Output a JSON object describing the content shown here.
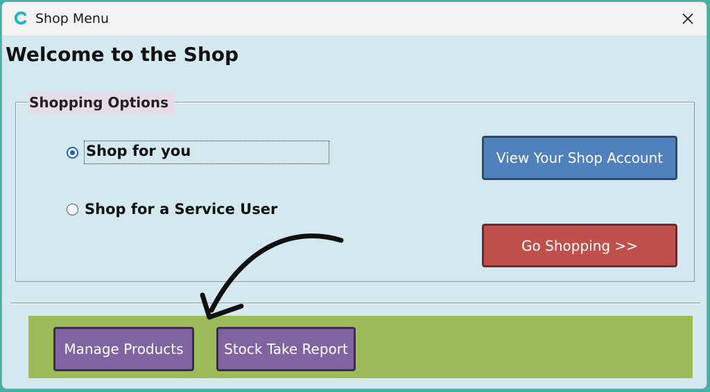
{
  "window": {
    "title": "Shop Menu",
    "app_icon": "c-logo-icon",
    "close_icon": "close-icon"
  },
  "welcome": "Welcome to the Shop",
  "shopping_options": {
    "legend": "Shopping Options",
    "radios": [
      {
        "label": "Shop for you",
        "checked": true
      },
      {
        "label": "Shop for a Service User",
        "checked": false
      }
    ],
    "view_account_label": "View Your Shop Account",
    "go_shopping_label": "Go Shopping >>"
  },
  "admin": {
    "manage_products_label": "Manage Products",
    "stock_take_label": "Stock Take Report"
  },
  "colors": {
    "window_bg": "#d3e9ef",
    "blue_button": "#4f81bd",
    "red_button": "#c0504d",
    "green_panel": "#9bbb59",
    "purple_button": "#8064a2",
    "legend_bg": "#e6dbe6",
    "radio_accent": "#1565c0"
  }
}
